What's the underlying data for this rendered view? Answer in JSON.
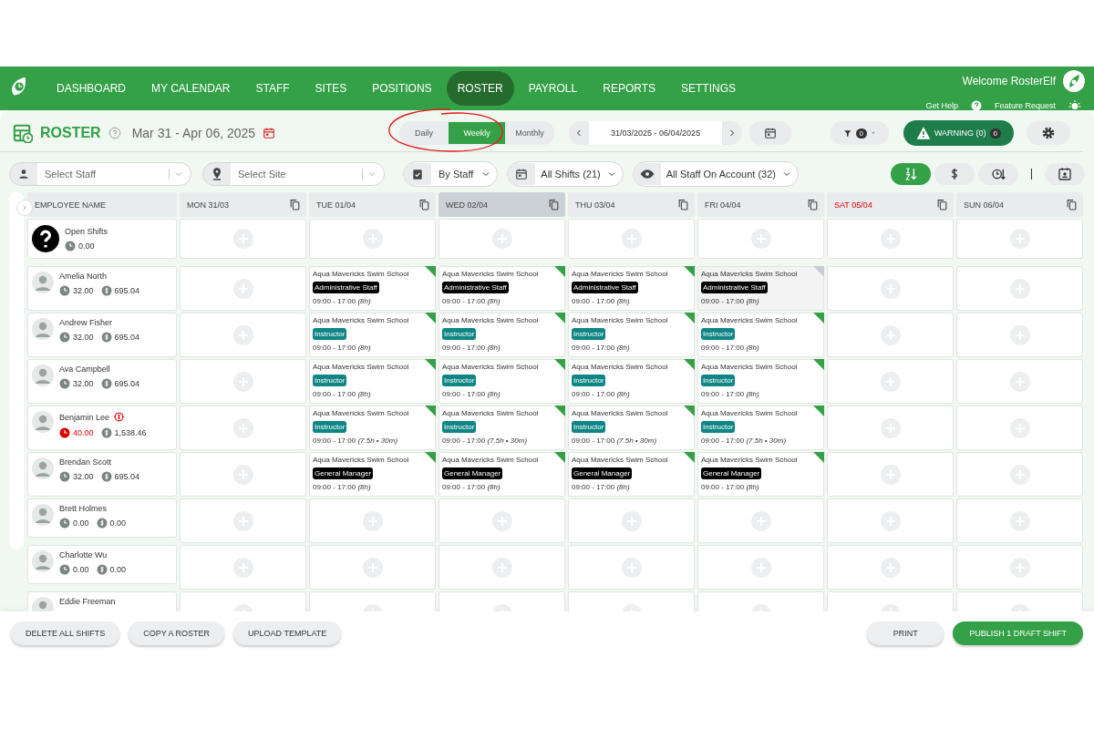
{
  "nav": {
    "items": [
      {
        "label": "DASHBOARD",
        "selected": false
      },
      {
        "label": "MY CALENDAR",
        "selected": false
      },
      {
        "label": "STAFF",
        "selected": false
      },
      {
        "label": "SITES",
        "selected": false
      },
      {
        "label": "POSITIONS",
        "selected": false
      },
      {
        "label": "ROSTER",
        "selected": true
      },
      {
        "label": "PAYROLL",
        "selected": false
      },
      {
        "label": "REPORTS",
        "selected": false
      },
      {
        "label": "SETTINGS",
        "selected": false
      }
    ],
    "welcome": "Welcome RosterElf",
    "help": "Get Help",
    "feature_request": "Feature Request"
  },
  "header": {
    "title": "ROSTER",
    "date_range": "Mar 31 - Apr 06, 2025",
    "views": [
      {
        "label": "Daily",
        "selected": false
      },
      {
        "label": "Weekly",
        "selected": true
      },
      {
        "label": "Monthly",
        "selected": false
      }
    ],
    "period": "31/03/2025 - 06/04/2025",
    "filter_count": "0",
    "warning": "WARNING (0)",
    "warning_count": "0"
  },
  "filters": {
    "staff_placeholder": "Select Staff",
    "site_placeholder": "Select Site",
    "group_by": "By Staff",
    "shifts": "All Shifts (21)",
    "staff_scope": "All Staff On Account (32)",
    "sort_options": [
      {
        "kind": "alpha",
        "selected": true
      },
      {
        "kind": "cost",
        "selected": false
      },
      {
        "kind": "hours",
        "selected": false
      }
    ]
  },
  "table": {
    "name_column": "EMPLOYEE NAME",
    "days": [
      {
        "label": "MON 31/03",
        "kind": "normal"
      },
      {
        "label": "TUE 01/04",
        "kind": "normal"
      },
      {
        "label": "WED 02/04",
        "kind": "today"
      },
      {
        "label": "THU 03/04",
        "kind": "normal"
      },
      {
        "label": "FRI 04/04",
        "kind": "normal"
      },
      {
        "label": "SAT 05/04",
        "kind": "holiday"
      },
      {
        "label": "SUN 06/04",
        "kind": "normal"
      }
    ],
    "open_shifts": {
      "name": "Open Shifts",
      "hours": "0.00"
    },
    "rows": [
      {
        "name": "Amelia North",
        "hours": "32.00",
        "cost": "695.04",
        "over_hours": false,
        "flagged": false,
        "cells": [
          {
            "kind": "empty"
          },
          {
            "kind": "shift",
            "site": "Aqua Mavericks Swim School",
            "position": "Administrative Staff",
            "color": "#000000",
            "time": "09:00 - 17:00 *(8h)*",
            "draft": false
          },
          {
            "kind": "shift",
            "site": "Aqua Mavericks Swim School",
            "position": "Administrative Staff",
            "color": "#000000",
            "time": "09:00 - 17:00 *(8h)*",
            "draft": false
          },
          {
            "kind": "shift",
            "site": "Aqua Mavericks Swim School",
            "position": "Administrative Staff",
            "color": "#000000",
            "time": "09:00 - 17:00 *(8h)*",
            "draft": false
          },
          {
            "kind": "shift",
            "site": "Aqua Mavericks Swim School",
            "position": "Administrative Staff",
            "color": "#000000",
            "time": "09:00 - 17:00 *(8h)*",
            "draft": true
          },
          {
            "kind": "empty"
          },
          {
            "kind": "empty"
          }
        ]
      },
      {
        "name": "Andrew Fisher",
        "hours": "32.00",
        "cost": "695.04",
        "over_hours": false,
        "flagged": false,
        "cells": [
          {
            "kind": "empty"
          },
          {
            "kind": "shift",
            "site": "Aqua Mavericks Swim School",
            "position": "Instructor",
            "color": "#0f8585",
            "time": "09:00 - 17:00 *(8h)*",
            "draft": false
          },
          {
            "kind": "shift",
            "site": "Aqua Mavericks Swim School",
            "position": "Instructor",
            "color": "#0f8585",
            "time": "09:00 - 17:00 *(8h)*",
            "draft": false
          },
          {
            "kind": "shift",
            "site": "Aqua Mavericks Swim School",
            "position": "Instructor",
            "color": "#0f8585",
            "time": "09:00 - 17:00 *(8h)*",
            "draft": false
          },
          {
            "kind": "shift",
            "site": "Aqua Mavericks Swim School",
            "position": "Instructor",
            "color": "#0f8585",
            "time": "09:00 - 17:00 *(8h)*",
            "draft": false
          },
          {
            "kind": "empty"
          },
          {
            "kind": "empty"
          }
        ]
      },
      {
        "name": "Ava Campbell",
        "hours": "32.00",
        "cost": "695.04",
        "over_hours": false,
        "flagged": false,
        "cells": [
          {
            "kind": "empty"
          },
          {
            "kind": "shift",
            "site": "Aqua Mavericks Swim School",
            "position": "Instructor",
            "color": "#0f8585",
            "time": "09:00 - 17:00 *(8h)*",
            "draft": false
          },
          {
            "kind": "shift",
            "site": "Aqua Mavericks Swim School",
            "position": "Instructor",
            "color": "#0f8585",
            "time": "09:00 - 17:00 *(8h)*",
            "draft": false
          },
          {
            "kind": "shift",
            "site": "Aqua Mavericks Swim School",
            "position": "Instructor",
            "color": "#0f8585",
            "time": "09:00 - 17:00 *(8h)*",
            "draft": false
          },
          {
            "kind": "shift",
            "site": "Aqua Mavericks Swim School",
            "position": "Instructor",
            "color": "#0f8585",
            "time": "09:00 - 17:00 *(8h)*",
            "draft": false
          },
          {
            "kind": "empty"
          },
          {
            "kind": "empty"
          }
        ]
      },
      {
        "name": "Benjamin Lee",
        "hours": "40.00",
        "cost": "1,538.46",
        "over_hours": true,
        "flagged": true,
        "cells": [
          {
            "kind": "empty"
          },
          {
            "kind": "shift",
            "site": "Aqua Mavericks Swim School",
            "position": "Instructor",
            "color": "#0f8585",
            "time": "09:00 - 17:00 *(7.5h • 30m)*",
            "draft": false
          },
          {
            "kind": "shift",
            "site": "Aqua Mavericks Swim School",
            "position": "Instructor",
            "color": "#0f8585",
            "time": "09:00 - 17:00 *(7.5h • 30m)*",
            "draft": false
          },
          {
            "kind": "shift",
            "site": "Aqua Mavericks Swim School",
            "position": "Instructor",
            "color": "#0f8585",
            "time": "09:00 - 17:00 *(7.5h • 30m)*",
            "draft": false
          },
          {
            "kind": "shift",
            "site": "Aqua Mavericks Swim School",
            "position": "Instructor",
            "color": "#0f8585",
            "time": "09:00 - 17:00 *(7.5h • 30m)*",
            "draft": false
          },
          {
            "kind": "empty"
          },
          {
            "kind": "empty"
          }
        ]
      },
      {
        "name": "Brendan Scott",
        "hours": "32.00",
        "cost": "695.04",
        "over_hours": false,
        "flagged": false,
        "cells": [
          {
            "kind": "empty"
          },
          {
            "kind": "shift",
            "site": "Aqua Mavericks Swim School",
            "position": "General Manager",
            "color": "#000000",
            "time": "09:00 - 17:00 *(8h)*",
            "draft": false
          },
          {
            "kind": "shift",
            "site": "Aqua Mavericks Swim School",
            "position": "General Manager",
            "color": "#000000",
            "time": "09:00 - 17:00 *(8h)*",
            "draft": false
          },
          {
            "kind": "shift",
            "site": "Aqua Mavericks Swim School",
            "position": "General Manager",
            "color": "#000000",
            "time": "09:00 - 17:00 *(8h)*",
            "draft": false
          },
          {
            "kind": "shift",
            "site": "Aqua Mavericks Swim School",
            "position": "General Manager",
            "color": "#000000",
            "time": "09:00 - 17:00 *(8h)*",
            "draft": false
          },
          {
            "kind": "empty"
          },
          {
            "kind": "empty"
          }
        ]
      },
      {
        "name": "Brett Holmes",
        "hours": "0.00",
        "cost": "0.00",
        "over_hours": false,
        "flagged": false,
        "cells": [
          {
            "kind": "empty"
          },
          {
            "kind": "empty"
          },
          {
            "kind": "empty"
          },
          {
            "kind": "empty"
          },
          {
            "kind": "empty"
          },
          {
            "kind": "empty"
          },
          {
            "kind": "empty"
          }
        ]
      },
      {
        "name": "Charlotte Wu",
        "hours": "0.00",
        "cost": "0.00",
        "over_hours": false,
        "flagged": false,
        "cells": [
          {
            "kind": "empty"
          },
          {
            "kind": "empty"
          },
          {
            "kind": "empty"
          },
          {
            "kind": "empty"
          },
          {
            "kind": "empty"
          },
          {
            "kind": "empty"
          },
          {
            "kind": "empty"
          }
        ]
      },
      {
        "name": "Eddie Freeman",
        "flagged": false,
        "cells": [
          {
            "kind": "empty"
          },
          {
            "kind": "empty"
          },
          {
            "kind": "empty"
          },
          {
            "kind": "empty"
          },
          {
            "kind": "empty"
          },
          {
            "kind": "empty"
          },
          {
            "kind": "empty"
          }
        ]
      }
    ]
  },
  "footer": {
    "left_buttons": [
      "DELETE ALL SHIFTS",
      "COPY A ROSTER",
      "UPLOAD TEMPLATE"
    ],
    "print": "PRINT",
    "publish": "PUBLISH 1 DRAFT SHIFT"
  }
}
